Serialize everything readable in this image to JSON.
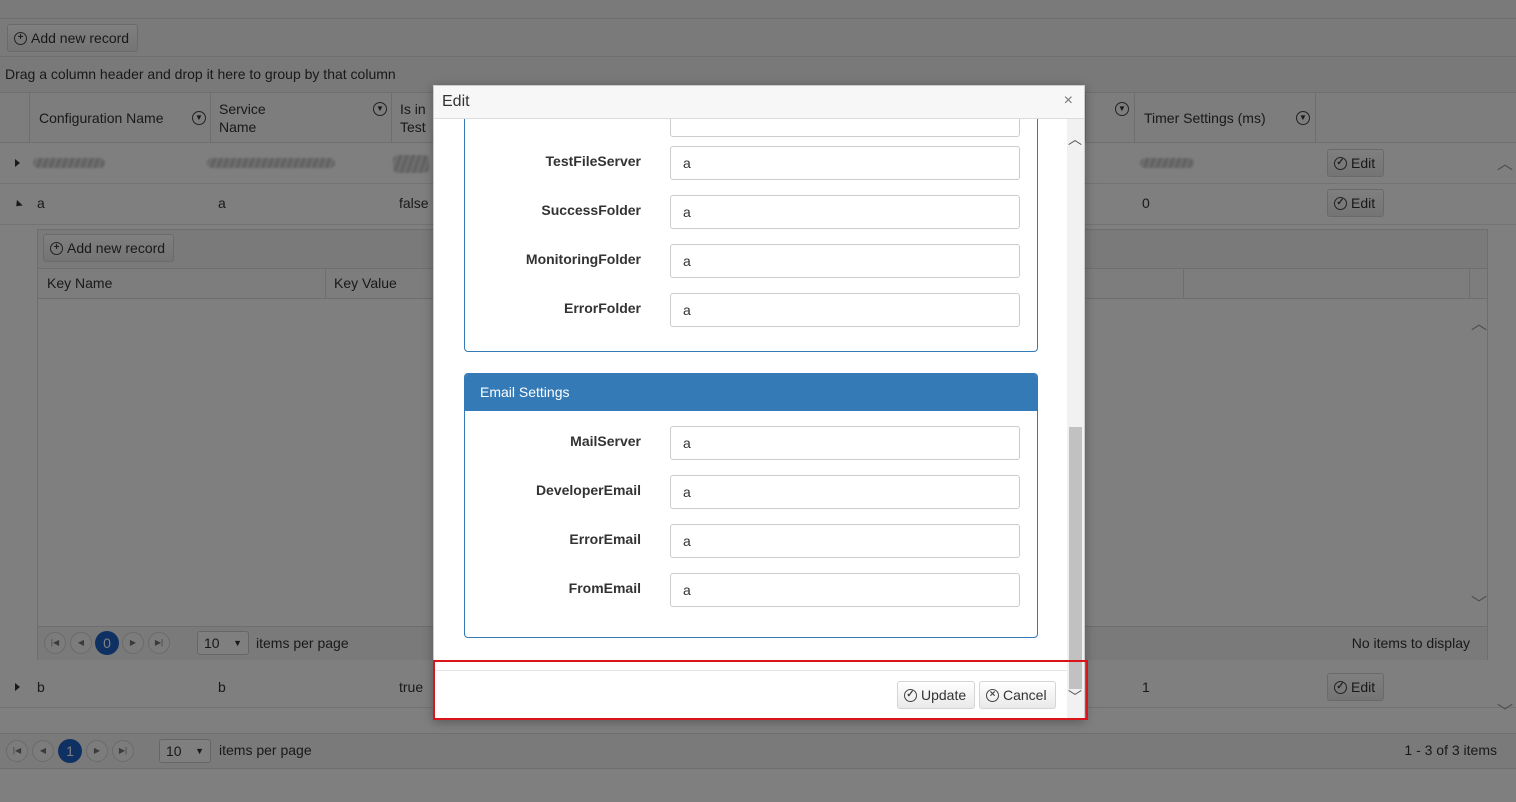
{
  "toolbar": {
    "add_label": "Add new record"
  },
  "grouping_hint": "Drag a column header and drop it here to group by that column",
  "columns": [
    {
      "label": "Configuration Name"
    },
    {
      "label": "Service Name"
    },
    {
      "label": "Is in Test"
    },
    {
      "label": "Timer Settings (ms)"
    }
  ],
  "rows": [
    {
      "config": "",
      "service": "",
      "is_test": "",
      "timer": "",
      "edit": "Edit"
    },
    {
      "config": "a",
      "service": "a",
      "is_test": "false",
      "timer": "0",
      "edit": "Edit"
    },
    {
      "config": "b",
      "service": "b",
      "is_test": "true",
      "timer": "1",
      "edit": "Edit"
    }
  ],
  "detail": {
    "add_label": "Add new record",
    "columns": [
      "Key Name",
      "Key Value"
    ],
    "pager": {
      "page": "0",
      "page_size": "10",
      "items_per_page": "items per page",
      "status": "No items to display"
    }
  },
  "pager": {
    "page": "1",
    "page_size": "10",
    "items_per_page": "items per page",
    "status": "1 - 3 of 3 items"
  },
  "modal": {
    "title": "Edit",
    "close": "×",
    "file_fields": [
      {
        "label": "TestFileServer",
        "value": "a"
      },
      {
        "label": "SuccessFolder",
        "value": "a"
      },
      {
        "label": "MonitoringFolder",
        "value": "a"
      },
      {
        "label": "ErrorFolder",
        "value": "a"
      }
    ],
    "email_panel": {
      "title": "Email Settings",
      "fields": [
        {
          "label": "MailServer",
          "value": "a"
        },
        {
          "label": "DeveloperEmail",
          "value": "a"
        },
        {
          "label": "ErrorEmail",
          "value": "a"
        },
        {
          "label": "FromEmail",
          "value": "a"
        }
      ]
    },
    "update_label": "Update",
    "cancel_label": "Cancel"
  },
  "colors": {
    "panel_header": "#337ab7",
    "pager_current": "#1f60c4",
    "highlight": "#d9151b"
  }
}
